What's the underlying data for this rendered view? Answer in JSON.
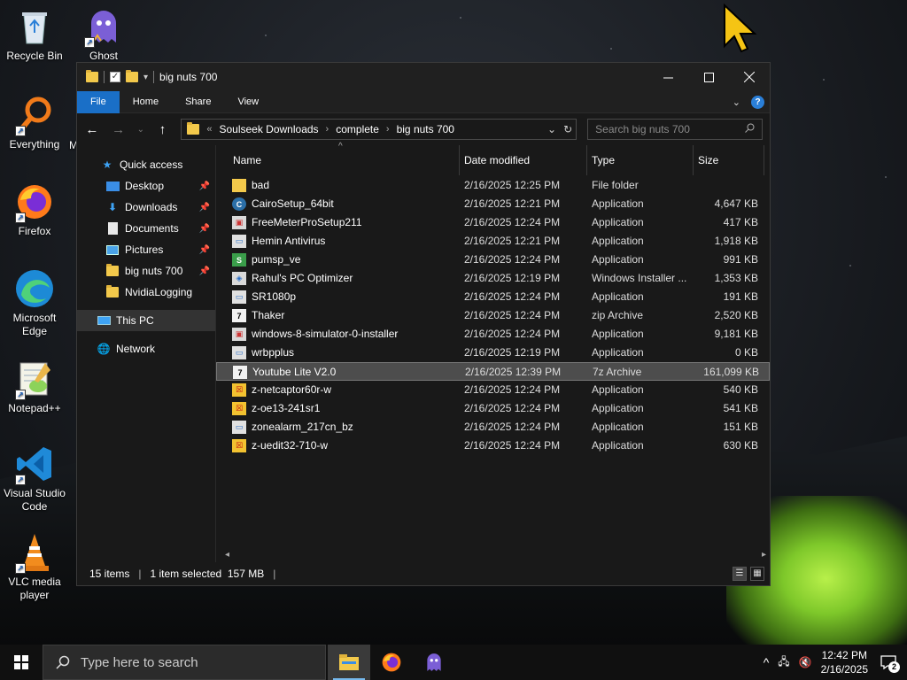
{
  "desktop": {
    "icons": [
      {
        "label": "Recycle Bin"
      },
      {
        "label": "Ghost"
      },
      {
        "label": "Everything"
      },
      {
        "label": "M"
      },
      {
        "label": "Firefox"
      },
      {
        "label": "Microsoft Edge"
      },
      {
        "label": "Notepad++"
      },
      {
        "label": "Visual Studio Code"
      },
      {
        "label": "VLC media player"
      }
    ]
  },
  "window": {
    "title": "big nuts 700",
    "ribbon_tabs": [
      "File",
      "Home",
      "Share",
      "View"
    ],
    "address": {
      "prefix": "«",
      "crumbs": [
        "Soulseek Downloads",
        "complete",
        "big nuts 700"
      ]
    },
    "search": {
      "placeholder": "Search big nuts 700"
    },
    "nav_pane": {
      "quick_access": "Quick access",
      "items": [
        {
          "label": "Desktop",
          "pinned": true
        },
        {
          "label": "Downloads",
          "pinned": true
        },
        {
          "label": "Documents",
          "pinned": true
        },
        {
          "label": "Pictures",
          "pinned": true
        },
        {
          "label": "big nuts 700",
          "pinned": true
        },
        {
          "label": "NvidiaLogging",
          "pinned": false
        }
      ],
      "this_pc": "This PC",
      "network": "Network"
    },
    "columns": {
      "name": "Name",
      "date": "Date modified",
      "type": "Type",
      "size": "Size"
    },
    "files": [
      {
        "name": "bad",
        "date": "2/16/2025 12:25 PM",
        "type": "File folder",
        "size": "",
        "icon": "folder-icon"
      },
      {
        "name": "CairoSetup_64bit",
        "date": "2/16/2025 12:21 PM",
        "type": "Application",
        "size": "4,647 KB",
        "icon": "cairo-setup-icon"
      },
      {
        "name": "FreeMeterProSetup211",
        "date": "2/16/2025 12:24 PM",
        "type": "Application",
        "size": "417 KB",
        "icon": "installer-icon"
      },
      {
        "name": "Hemin Antivirus",
        "date": "2/16/2025 12:21 PM",
        "type": "Application",
        "size": "1,918 KB",
        "icon": "application-icon"
      },
      {
        "name": "pumsp_ve",
        "date": "2/16/2025 12:24 PM",
        "type": "Application",
        "size": "991 KB",
        "icon": "setup-icon"
      },
      {
        "name": "Rahul's PC Optimizer",
        "date": "2/16/2025 12:19 PM",
        "type": "Windows Installer ...",
        "size": "1,353 KB",
        "icon": "msi-icon"
      },
      {
        "name": "SR1080p",
        "date": "2/16/2025 12:24 PM",
        "type": "Application",
        "size": "191 KB",
        "icon": "application-icon"
      },
      {
        "name": "Thaker",
        "date": "2/16/2025 12:24 PM",
        "type": "zip Archive",
        "size": "2,520 KB",
        "icon": "archive-icon"
      },
      {
        "name": "windows-8-simulator-0-installer",
        "date": "2/16/2025 12:24 PM",
        "type": "Application",
        "size": "9,181 KB",
        "icon": "installer-icon"
      },
      {
        "name": "wrbpplus",
        "date": "2/16/2025 12:19 PM",
        "type": "Application",
        "size": "0 KB",
        "icon": "application-icon"
      },
      {
        "name": "Youtube Lite V2.0",
        "date": "2/16/2025 12:39 PM",
        "type": "7z Archive",
        "size": "161,099 KB",
        "icon": "archive-icon",
        "selected": true
      },
      {
        "name": "z-netcaptor60r-w",
        "date": "2/16/2025 12:24 PM",
        "type": "Application",
        "size": "540 KB",
        "icon": "z-app-icon"
      },
      {
        "name": "z-oe13-241sr1",
        "date": "2/16/2025 12:24 PM",
        "type": "Application",
        "size": "541 KB",
        "icon": "z-app-icon"
      },
      {
        "name": "zonealarm_217cn_bz",
        "date": "2/16/2025 12:24 PM",
        "type": "Application",
        "size": "151 KB",
        "icon": "application-icon"
      },
      {
        "name": "z-uedit32-710-w",
        "date": "2/16/2025 12:24 PM",
        "type": "Application",
        "size": "630 KB",
        "icon": "z-app-icon"
      }
    ],
    "status": {
      "count": "15 items",
      "selection": "1 item selected  157 MB"
    }
  },
  "taskbar": {
    "search_placeholder": "Type here to search",
    "time": "12:42 PM",
    "date": "2/16/2025",
    "notifications": "2"
  },
  "colors": {
    "accent": "#1a6fc7",
    "folder": "#f3c94b",
    "selected_row": "#4d4d4d"
  }
}
